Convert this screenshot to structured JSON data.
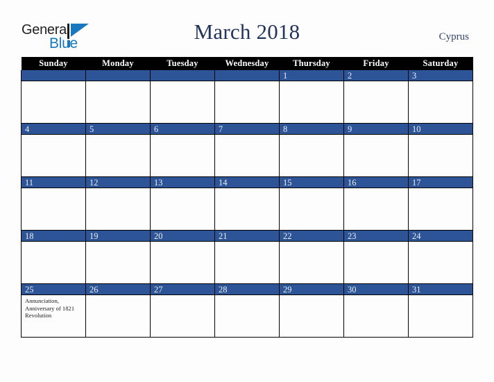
{
  "logo": {
    "text_primary": "General",
    "text_secondary": "Blue",
    "primary_color": "#231f20",
    "accent_color": "#1878be"
  },
  "header": {
    "title": "March 2018",
    "region": "Cyprus",
    "title_color": "#23345c"
  },
  "calendar": {
    "weekday_headers": [
      "Sunday",
      "Monday",
      "Tuesday",
      "Wednesday",
      "Thursday",
      "Friday",
      "Saturday"
    ],
    "header_bg": "#000000",
    "daynum_bg": "#2d5496",
    "daynum_color": "#e9eef7",
    "weeks": [
      [
        {
          "day": "",
          "events": ""
        },
        {
          "day": "",
          "events": ""
        },
        {
          "day": "",
          "events": ""
        },
        {
          "day": "",
          "events": ""
        },
        {
          "day": "1",
          "events": ""
        },
        {
          "day": "2",
          "events": ""
        },
        {
          "day": "3",
          "events": ""
        }
      ],
      [
        {
          "day": "4",
          "events": ""
        },
        {
          "day": "5",
          "events": ""
        },
        {
          "day": "6",
          "events": ""
        },
        {
          "day": "7",
          "events": ""
        },
        {
          "day": "8",
          "events": ""
        },
        {
          "day": "9",
          "events": ""
        },
        {
          "day": "10",
          "events": ""
        }
      ],
      [
        {
          "day": "11",
          "events": ""
        },
        {
          "day": "12",
          "events": ""
        },
        {
          "day": "13",
          "events": ""
        },
        {
          "day": "14",
          "events": ""
        },
        {
          "day": "15",
          "events": ""
        },
        {
          "day": "16",
          "events": ""
        },
        {
          "day": "17",
          "events": ""
        }
      ],
      [
        {
          "day": "18",
          "events": ""
        },
        {
          "day": "19",
          "events": ""
        },
        {
          "day": "20",
          "events": ""
        },
        {
          "day": "21",
          "events": ""
        },
        {
          "day": "22",
          "events": ""
        },
        {
          "day": "23",
          "events": ""
        },
        {
          "day": "24",
          "events": ""
        }
      ],
      [
        {
          "day": "25",
          "events": "Annunciation, Anniversary of 1821 Revolution"
        },
        {
          "day": "26",
          "events": ""
        },
        {
          "day": "27",
          "events": ""
        },
        {
          "day": "28",
          "events": ""
        },
        {
          "day": "29",
          "events": ""
        },
        {
          "day": "30",
          "events": ""
        },
        {
          "day": "31",
          "events": ""
        }
      ]
    ]
  }
}
